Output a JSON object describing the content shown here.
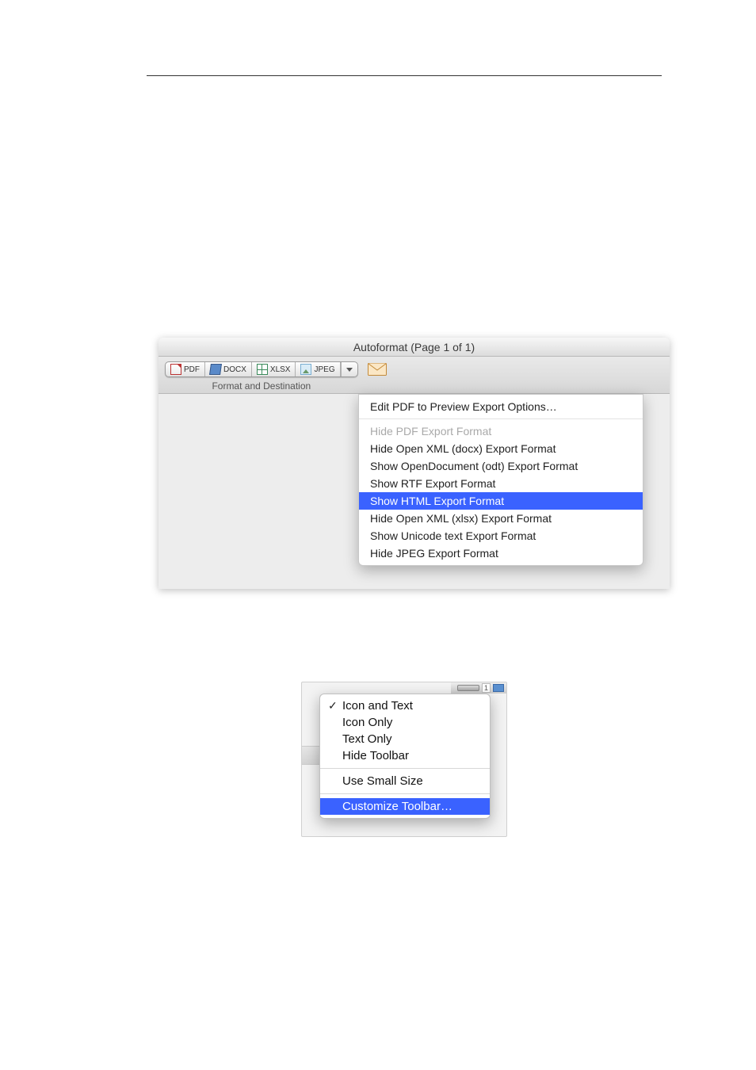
{
  "autoformat": {
    "title": "Autoformat (Page 1 of 1)",
    "toolbar_label": "Format and Destination",
    "segments": [
      {
        "label": "PDF",
        "icon": "pdf-icon"
      },
      {
        "label": "DOCX",
        "icon": "docx-icon"
      },
      {
        "label": "XLSX",
        "icon": "xlsx-icon"
      },
      {
        "label": "JPEG",
        "icon": "jpeg-icon"
      }
    ],
    "menu": {
      "top": "Edit PDF to Preview Export Options…",
      "items": [
        {
          "label": "Hide PDF Export Format",
          "disabled": true,
          "selected": false
        },
        {
          "label": "Hide Open XML (docx) Export Format",
          "disabled": false,
          "selected": false
        },
        {
          "label": "Show OpenDocument (odt) Export Format",
          "disabled": false,
          "selected": false
        },
        {
          "label": "Show RTF Export Format",
          "disabled": false,
          "selected": false
        },
        {
          "label": "Show HTML Export Format",
          "disabled": false,
          "selected": true
        },
        {
          "label": "Hide Open XML (xlsx) Export Format",
          "disabled": false,
          "selected": false
        },
        {
          "label": "Show Unicode text Export Format",
          "disabled": false,
          "selected": false
        },
        {
          "label": "Hide JPEG Export Format",
          "disabled": false,
          "selected": false
        }
      ]
    }
  },
  "context_menu": {
    "titlebar_number": "1",
    "groups": [
      [
        {
          "label": "Icon and Text",
          "checked": true,
          "selected": false
        },
        {
          "label": "Icon Only",
          "checked": false,
          "selected": false
        },
        {
          "label": "Text Only",
          "checked": false,
          "selected": false
        },
        {
          "label": "Hide Toolbar",
          "checked": false,
          "selected": false
        }
      ],
      [
        {
          "label": "Use Small Size",
          "checked": false,
          "selected": false
        }
      ],
      [
        {
          "label": "Customize Toolbar…",
          "checked": false,
          "selected": true
        }
      ]
    ]
  }
}
